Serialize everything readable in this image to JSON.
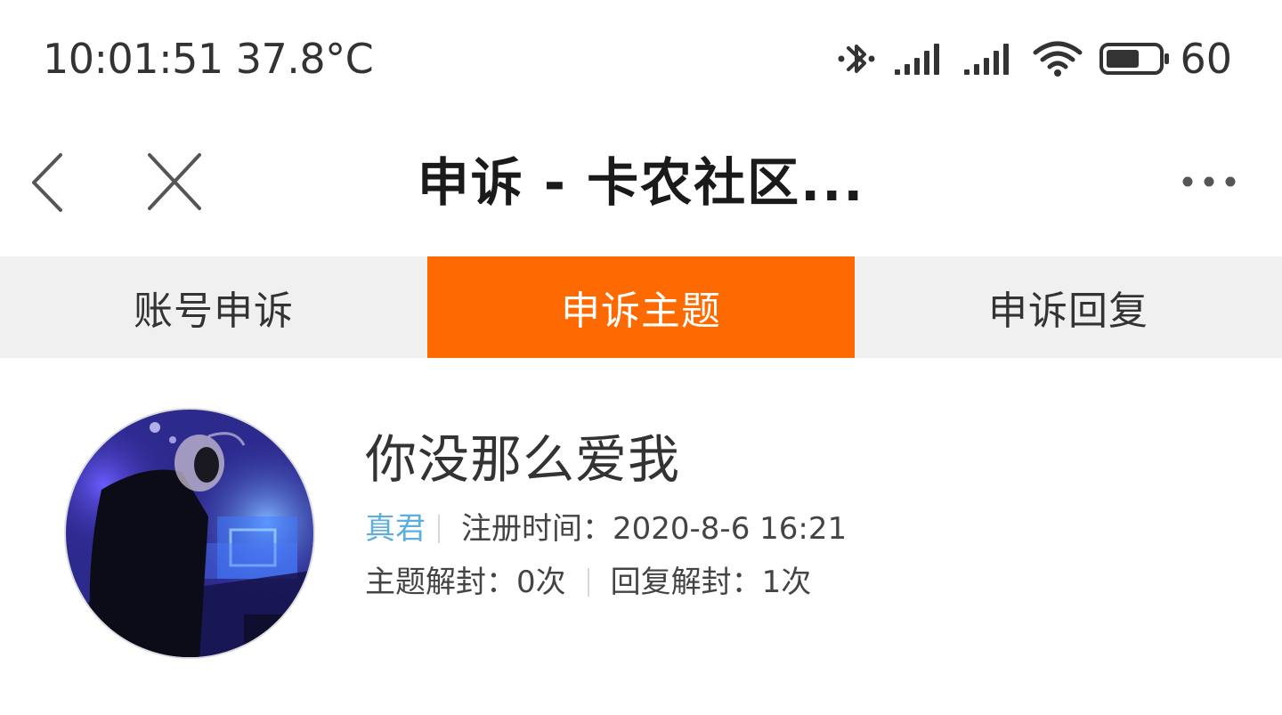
{
  "status_bar": {
    "time_temp": "10:01:51 37.8°C",
    "battery_percent": "60",
    "icons": [
      "bluetooth-icon",
      "signal-icon",
      "signal-icon",
      "wifi-icon",
      "battery-icon"
    ]
  },
  "nav": {
    "title": "申诉 - 卡农社区...",
    "back_icon": "chevron-left-icon",
    "close_icon": "close-icon",
    "more_icon": "more-horizontal-icon"
  },
  "tabs": [
    {
      "label": "账号申诉",
      "active": false
    },
    {
      "label": "申诉主题",
      "active": true
    },
    {
      "label": "申诉回复",
      "active": false
    }
  ],
  "profile": {
    "username": "你没那么爱我",
    "rank": "真君",
    "register_label": "注册时间：",
    "register_date": "2020-8-6 16:21",
    "topic_unban_label": "主题解封：",
    "topic_unban_count": "0次",
    "reply_unban_label": "回复解封：",
    "reply_unban_count": "1次"
  },
  "colors": {
    "accent": "#ff6a00",
    "tab_bg": "#f0f0f0",
    "rank_color": "#5aaee0"
  }
}
